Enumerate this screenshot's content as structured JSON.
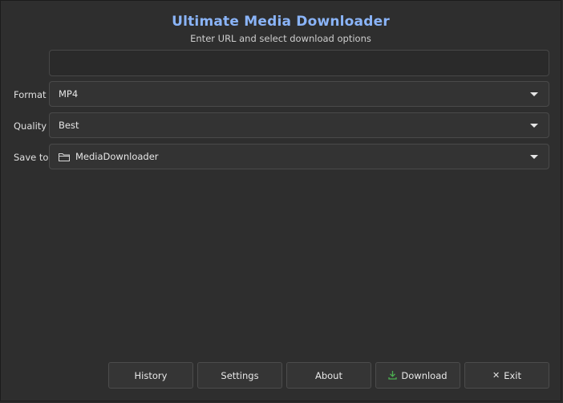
{
  "header": {
    "title": "Ultimate Media Downloader",
    "subtitle": "Enter URL and select download options"
  },
  "url": {
    "value": "",
    "placeholder": ""
  },
  "format": {
    "label": "Format",
    "selected": "MP4"
  },
  "quality": {
    "label": "Quality",
    "selected": "Best"
  },
  "save_to": {
    "label": "Save to",
    "selected": "MediaDownloader",
    "icon": "folder-icon"
  },
  "buttons": {
    "history": "History",
    "settings": "Settings",
    "about": "About",
    "download": "Download",
    "exit": "Exit"
  },
  "colors": {
    "title": "#8ab4f8",
    "download_icon": "#4caf50",
    "background": "#2e2e2e"
  }
}
